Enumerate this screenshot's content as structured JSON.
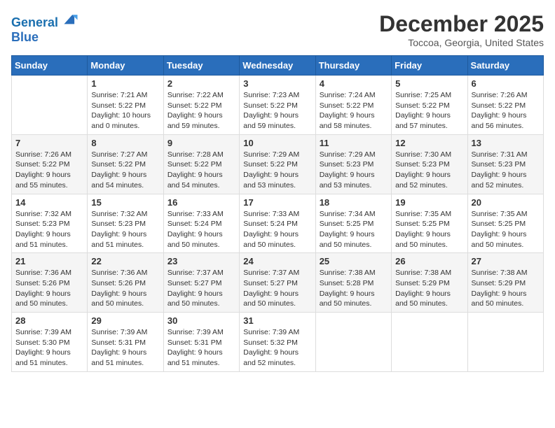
{
  "header": {
    "logo_line1": "General",
    "logo_line2": "Blue",
    "month_title": "December 2025",
    "location": "Toccoa, Georgia, United States"
  },
  "weekdays": [
    "Sunday",
    "Monday",
    "Tuesday",
    "Wednesday",
    "Thursday",
    "Friday",
    "Saturday"
  ],
  "weeks": [
    [
      {
        "day": "",
        "sunrise": "",
        "sunset": "",
        "daylight": ""
      },
      {
        "day": "1",
        "sunrise": "7:21 AM",
        "sunset": "5:22 PM",
        "daylight": "10 hours and 0 minutes."
      },
      {
        "day": "2",
        "sunrise": "7:22 AM",
        "sunset": "5:22 PM",
        "daylight": "9 hours and 59 minutes."
      },
      {
        "day": "3",
        "sunrise": "7:23 AM",
        "sunset": "5:22 PM",
        "daylight": "9 hours and 59 minutes."
      },
      {
        "day": "4",
        "sunrise": "7:24 AM",
        "sunset": "5:22 PM",
        "daylight": "9 hours and 58 minutes."
      },
      {
        "day": "5",
        "sunrise": "7:25 AM",
        "sunset": "5:22 PM",
        "daylight": "9 hours and 57 minutes."
      },
      {
        "day": "6",
        "sunrise": "7:26 AM",
        "sunset": "5:22 PM",
        "daylight": "9 hours and 56 minutes."
      }
    ],
    [
      {
        "day": "7",
        "sunrise": "7:26 AM",
        "sunset": "5:22 PM",
        "daylight": "9 hours and 55 minutes."
      },
      {
        "day": "8",
        "sunrise": "7:27 AM",
        "sunset": "5:22 PM",
        "daylight": "9 hours and 54 minutes."
      },
      {
        "day": "9",
        "sunrise": "7:28 AM",
        "sunset": "5:22 PM",
        "daylight": "9 hours and 54 minutes."
      },
      {
        "day": "10",
        "sunrise": "7:29 AM",
        "sunset": "5:22 PM",
        "daylight": "9 hours and 53 minutes."
      },
      {
        "day": "11",
        "sunrise": "7:29 AM",
        "sunset": "5:23 PM",
        "daylight": "9 hours and 53 minutes."
      },
      {
        "day": "12",
        "sunrise": "7:30 AM",
        "sunset": "5:23 PM",
        "daylight": "9 hours and 52 minutes."
      },
      {
        "day": "13",
        "sunrise": "7:31 AM",
        "sunset": "5:23 PM",
        "daylight": "9 hours and 52 minutes."
      }
    ],
    [
      {
        "day": "14",
        "sunrise": "7:32 AM",
        "sunset": "5:23 PM",
        "daylight": "9 hours and 51 minutes."
      },
      {
        "day": "15",
        "sunrise": "7:32 AM",
        "sunset": "5:23 PM",
        "daylight": "9 hours and 51 minutes."
      },
      {
        "day": "16",
        "sunrise": "7:33 AM",
        "sunset": "5:24 PM",
        "daylight": "9 hours and 50 minutes."
      },
      {
        "day": "17",
        "sunrise": "7:33 AM",
        "sunset": "5:24 PM",
        "daylight": "9 hours and 50 minutes."
      },
      {
        "day": "18",
        "sunrise": "7:34 AM",
        "sunset": "5:25 PM",
        "daylight": "9 hours and 50 minutes."
      },
      {
        "day": "19",
        "sunrise": "7:35 AM",
        "sunset": "5:25 PM",
        "daylight": "9 hours and 50 minutes."
      },
      {
        "day": "20",
        "sunrise": "7:35 AM",
        "sunset": "5:25 PM",
        "daylight": "9 hours and 50 minutes."
      }
    ],
    [
      {
        "day": "21",
        "sunrise": "7:36 AM",
        "sunset": "5:26 PM",
        "daylight": "9 hours and 50 minutes."
      },
      {
        "day": "22",
        "sunrise": "7:36 AM",
        "sunset": "5:26 PM",
        "daylight": "9 hours and 50 minutes."
      },
      {
        "day": "23",
        "sunrise": "7:37 AM",
        "sunset": "5:27 PM",
        "daylight": "9 hours and 50 minutes."
      },
      {
        "day": "24",
        "sunrise": "7:37 AM",
        "sunset": "5:27 PM",
        "daylight": "9 hours and 50 minutes."
      },
      {
        "day": "25",
        "sunrise": "7:38 AM",
        "sunset": "5:28 PM",
        "daylight": "9 hours and 50 minutes."
      },
      {
        "day": "26",
        "sunrise": "7:38 AM",
        "sunset": "5:29 PM",
        "daylight": "9 hours and 50 minutes."
      },
      {
        "day": "27",
        "sunrise": "7:38 AM",
        "sunset": "5:29 PM",
        "daylight": "9 hours and 50 minutes."
      }
    ],
    [
      {
        "day": "28",
        "sunrise": "7:39 AM",
        "sunset": "5:30 PM",
        "daylight": "9 hours and 51 minutes."
      },
      {
        "day": "29",
        "sunrise": "7:39 AM",
        "sunset": "5:31 PM",
        "daylight": "9 hours and 51 minutes."
      },
      {
        "day": "30",
        "sunrise": "7:39 AM",
        "sunset": "5:31 PM",
        "daylight": "9 hours and 51 minutes."
      },
      {
        "day": "31",
        "sunrise": "7:39 AM",
        "sunset": "5:32 PM",
        "daylight": "9 hours and 52 minutes."
      },
      {
        "day": "",
        "sunrise": "",
        "sunset": "",
        "daylight": ""
      },
      {
        "day": "",
        "sunrise": "",
        "sunset": "",
        "daylight": ""
      },
      {
        "day": "",
        "sunrise": "",
        "sunset": "",
        "daylight": ""
      }
    ]
  ],
  "alt_rows": [
    1,
    3
  ]
}
